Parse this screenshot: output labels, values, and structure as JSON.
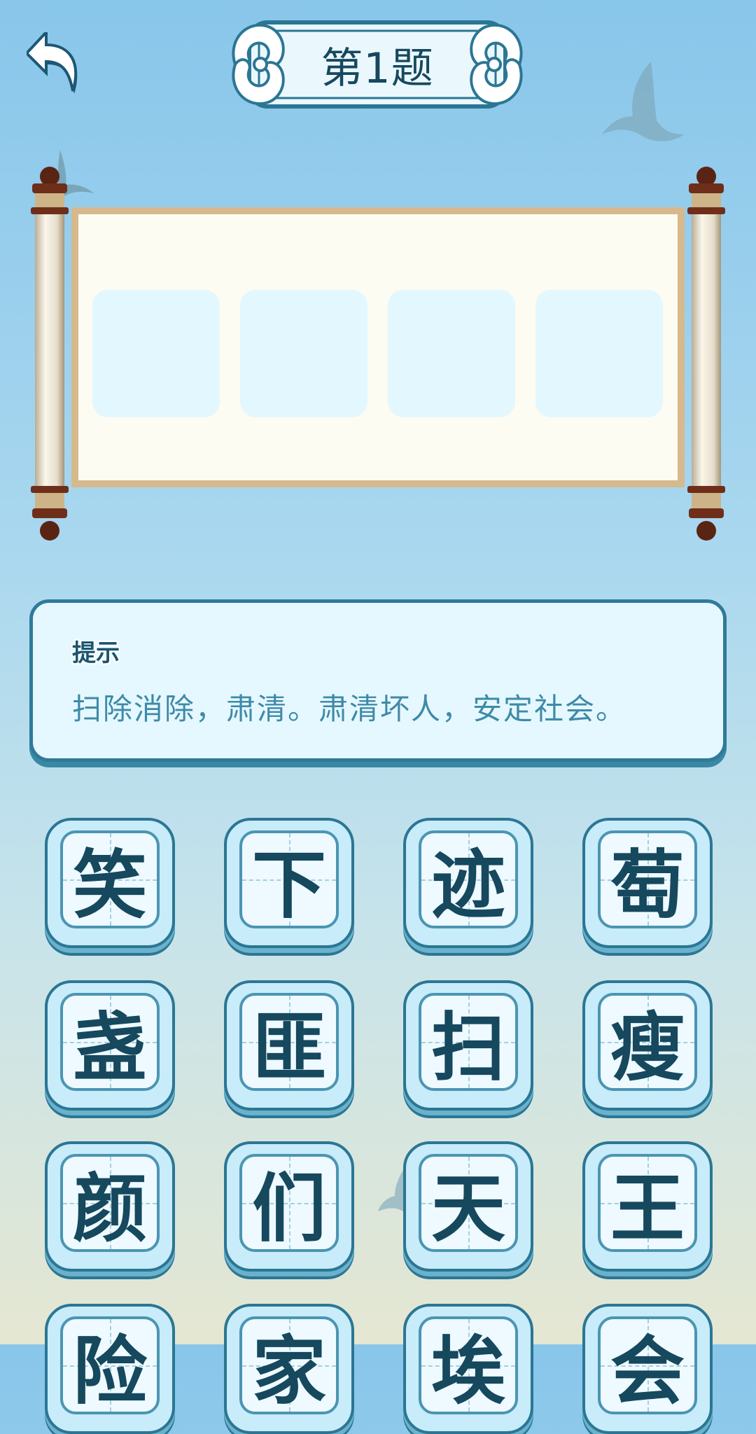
{
  "header": {
    "title": "第1题"
  },
  "answer": {
    "slots": [
      "",
      "",
      "",
      ""
    ]
  },
  "hint": {
    "title": "提示",
    "text": "扫除消除，肃清。肃清坏人，安定社会。"
  },
  "choices": [
    "笑",
    "下",
    "迹",
    "萄",
    "盏",
    "匪",
    "扫",
    "瘦",
    "颜",
    "们",
    "天",
    "王",
    "险",
    "家",
    "埃",
    "会"
  ],
  "colors": {
    "accent": "#2b7694",
    "text": "#16485e",
    "tile_fill": "#c8ecfa",
    "paper": "#fdfcf2",
    "slot": "#e3f7fe"
  }
}
